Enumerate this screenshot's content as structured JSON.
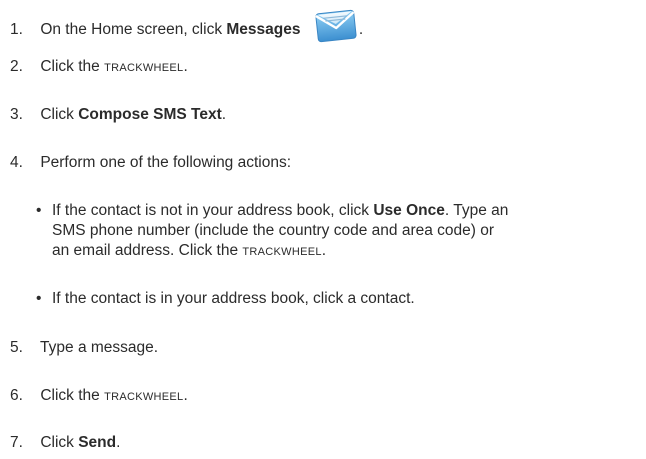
{
  "steps": [
    {
      "num": "1.",
      "pre": "On the Home screen, click ",
      "bold": "Messages",
      "post": "."
    },
    {
      "num": "2.",
      "pre": "Click the ",
      "sc": "TRACKWHEEL",
      "post": "."
    },
    {
      "num": "3.",
      "pre": "Click ",
      "bold": "Compose SMS Text",
      "post": "."
    },
    {
      "num": "4.",
      "text": "Perform one of the following actions:"
    },
    {
      "num": "5.",
      "text": "Type a message."
    },
    {
      "num": "6.",
      "pre": "Click the ",
      "sc": "TRACKWHEEL",
      "post": "."
    },
    {
      "num": "7.",
      "pre": "Click ",
      "bold": "Send",
      "post": "."
    }
  ],
  "bullets": [
    {
      "line1_pre": "If the contact is not in your address book, click ",
      "line1_bold": "Use Once",
      "line1_post": ". Type an",
      "line2": "SMS phone number (include the country code and area code) or",
      "line3_pre": "an email address. Click the ",
      "line3_sc": "TRACKWHEEL",
      "line3_post": "."
    },
    {
      "text": "If the contact is in your address book, click a contact."
    }
  ],
  "bullet_glyph": "•",
  "icons": {
    "messages": "envelope-icon",
    "envelope_color": "#5aa9de"
  }
}
